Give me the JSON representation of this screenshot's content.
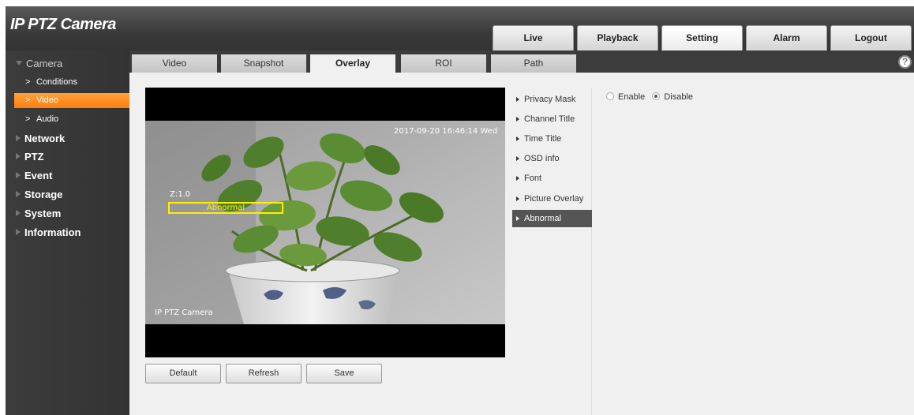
{
  "app": {
    "title": "IP PTZ Camera"
  },
  "top_nav": [
    "Live",
    "Playback",
    "Setting",
    "Alarm",
    "Logout"
  ],
  "top_nav_active": "Setting",
  "sidebar": {
    "camera": "Camera",
    "camera_subs": [
      "Conditions",
      "Video",
      "Audio"
    ],
    "active_sub": "Video",
    "sections": [
      "Network",
      "PTZ",
      "Event",
      "Storage",
      "System",
      "Information"
    ]
  },
  "subtabs": [
    "Video",
    "Snapshot",
    "Overlay",
    "ROI",
    "Path"
  ],
  "subtabs_active": "Overlay",
  "help_icon": "help-icon",
  "preview": {
    "datetime": "2017-09-20 16:46:14 Wed",
    "zoom": "Z:1.0",
    "abnormal_label": "Abnormal",
    "channel_title": "IP PTZ Camera"
  },
  "buttons": {
    "default": "Default",
    "refresh": "Refresh",
    "save": "Save"
  },
  "overlay_menu": [
    "Privacy Mask",
    "Channel Title",
    "Time Title",
    "OSD info",
    "Font",
    "Picture Overlay",
    "Abnormal"
  ],
  "overlay_menu_active": "Abnormal",
  "abnormal_settings": {
    "enable_label": "Enable",
    "disable_label": "Disable",
    "selected": "Disable"
  },
  "colors": {
    "accent": "#ff8a1c",
    "header": "#3a3a3a",
    "osd_box": "#ffee00"
  }
}
